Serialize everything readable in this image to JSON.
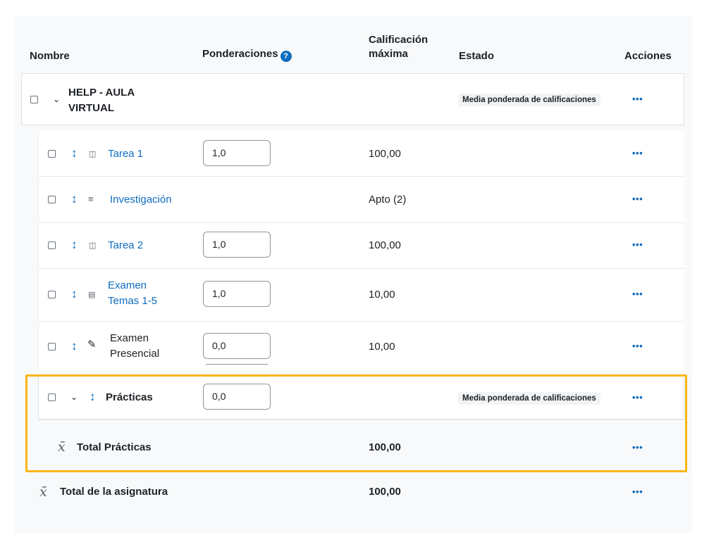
{
  "headers": {
    "nombre": "Nombre",
    "ponderaciones": "Ponderaciones",
    "calificacion_line1": "Calificación",
    "calificacion_line2": "máxima",
    "estado": "Estado",
    "acciones": "Acciones"
  },
  "category": {
    "name_line1": "HELP - AULA",
    "name_line2": "VIRTUAL",
    "estado": "Media ponderada de calificaciones"
  },
  "items": [
    {
      "name": "Tarea 1",
      "weight": "1,0",
      "max": "100,00",
      "icon": "assignment-icon"
    },
    {
      "name": "Investigación",
      "weight": "",
      "max": "Apto (2)",
      "icon": "checklist-icon"
    },
    {
      "name": "Tarea 2",
      "weight": "1,0",
      "max": "100,00",
      "icon": "assignment-icon"
    },
    {
      "name_line1": "Examen",
      "name_line2": "Temas 1-5",
      "weight": "1,0",
      "max": "10,00",
      "icon": "quiz-icon"
    },
    {
      "name_line1": "Examen",
      "name_line2": "Presencial",
      "weight": "0,0",
      "max": "10,00",
      "icon": "edit-icon"
    }
  ],
  "practicas": {
    "name": "Prácticas",
    "weight": "0,0",
    "estado": "Media ponderada de calificaciones"
  },
  "total_practicas": {
    "label": "Total Prácticas",
    "max": "100,00"
  },
  "total_asignatura": {
    "label": "Total de la asignatura",
    "max": "100,00"
  },
  "actions_label": "•••",
  "mean_symbol": "x̄",
  "colors": {
    "accent": "#0f6cbf",
    "highlight": "#f7b715",
    "text": "#1d2125"
  }
}
